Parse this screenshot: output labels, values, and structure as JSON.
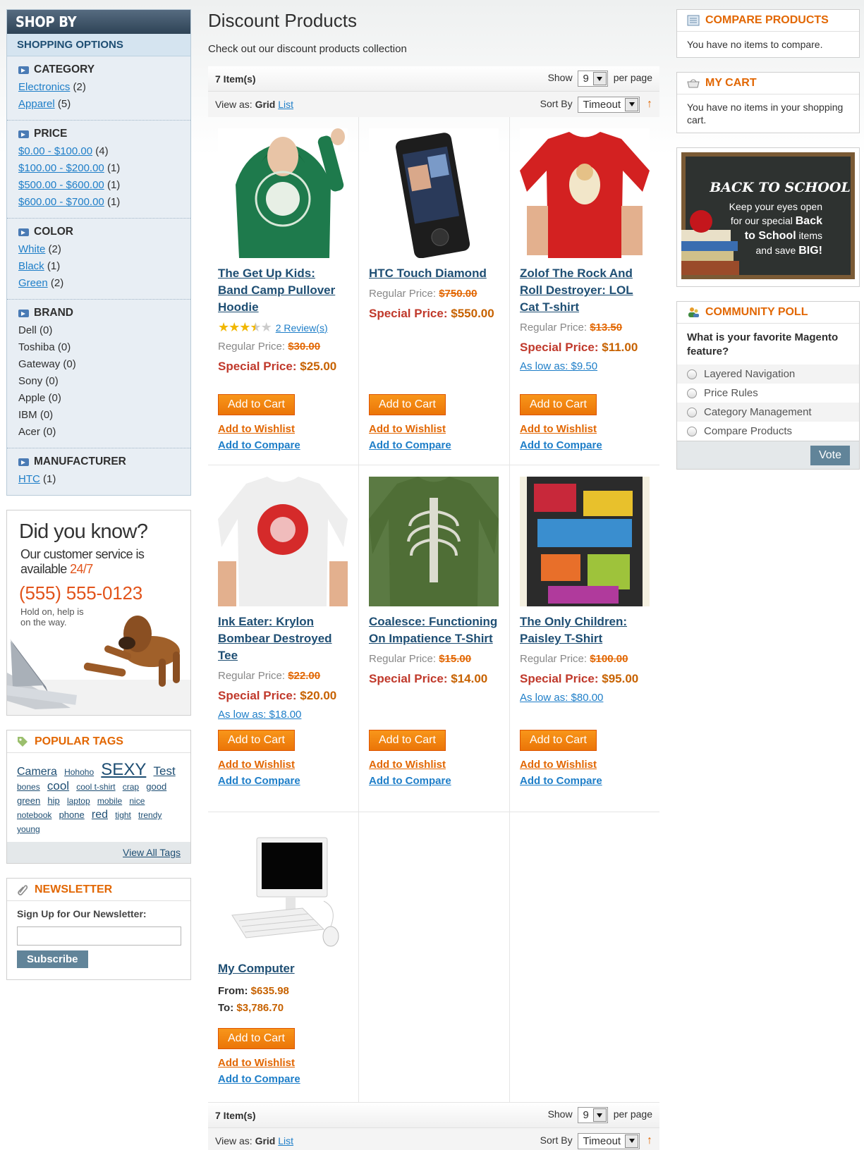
{
  "shopby": {
    "title": "SHOP BY",
    "subtitle": "SHOPPING OPTIONS",
    "filters": [
      {
        "name": "CATEGORY",
        "items": [
          {
            "label": "Electronics",
            "count": "(2)",
            "link": true
          },
          {
            "label": "Apparel",
            "count": "(5)",
            "link": true
          }
        ]
      },
      {
        "name": "PRICE",
        "items": [
          {
            "label": "$0.00 - $100.00",
            "count": "(4)",
            "link": true
          },
          {
            "label": "$100.00 - $200.00",
            "count": "(1)",
            "link": true
          },
          {
            "label": "$500.00 - $600.00",
            "count": "(1)",
            "link": true
          },
          {
            "label": "$600.00 - $700.00",
            "count": "(1)",
            "link": true
          }
        ]
      },
      {
        "name": "COLOR",
        "items": [
          {
            "label": "White",
            "count": "(2)",
            "link": true
          },
          {
            "label": "Black",
            "count": "(1)",
            "link": true
          },
          {
            "label": "Green",
            "count": "(2)",
            "link": true
          }
        ]
      },
      {
        "name": "BRAND",
        "items": [
          {
            "label": "Dell",
            "count": "(0)",
            "link": false
          },
          {
            "label": "Toshiba",
            "count": "(0)",
            "link": false
          },
          {
            "label": "Gateway",
            "count": "(0)",
            "link": false
          },
          {
            "label": "Sony",
            "count": "(0)",
            "link": false
          },
          {
            "label": "Apple",
            "count": "(0)",
            "link": false
          },
          {
            "label": "IBM",
            "count": "(0)",
            "link": false
          },
          {
            "label": "Acer",
            "count": "(0)",
            "link": false
          }
        ]
      },
      {
        "name": "MANUFACTURER",
        "items": [
          {
            "label": "HTC",
            "count": "(1)",
            "link": true
          }
        ]
      }
    ]
  },
  "didyouknow": {
    "title": "Did you know?",
    "line1": "Our customer service is",
    "line2": "available",
    "line2_highlight": "24/7",
    "phone": "(555) 555-0123",
    "hold1": "Hold on, help is",
    "hold2": "on the way."
  },
  "tags": {
    "title": "POPULAR TAGS",
    "items": [
      {
        "t": "Camera",
        "s": 3
      },
      {
        "t": "Hohoho",
        "s": 1
      },
      {
        "t": "SEXY",
        "s": 5
      },
      {
        "t": "Test",
        "s": 4
      },
      {
        "t": "bones",
        "s": 1
      },
      {
        "t": "cool",
        "s": 4
      },
      {
        "t": "cool t-shirt",
        "s": 1
      },
      {
        "t": "crap",
        "s": 1
      },
      {
        "t": "good",
        "s": 2
      },
      {
        "t": "green",
        "s": 2
      },
      {
        "t": "hip",
        "s": 2
      },
      {
        "t": "laptop",
        "s": 1
      },
      {
        "t": "mobile",
        "s": 1
      },
      {
        "t": "nice",
        "s": 1
      },
      {
        "t": "notebook",
        "s": 1
      },
      {
        "t": "phone",
        "s": 2
      },
      {
        "t": "red",
        "s": 3
      },
      {
        "t": "tight",
        "s": 1
      },
      {
        "t": "trendy",
        "s": 1
      },
      {
        "t": "young",
        "s": 1
      }
    ],
    "view_all": "View All Tags"
  },
  "newsletter": {
    "title": "NEWSLETTER",
    "label": "Sign Up for Our Newsletter:",
    "value": "",
    "button": "Subscribe"
  },
  "main": {
    "title": "Discount Products",
    "description": "Check out our discount products collection"
  },
  "toolbar": {
    "count": "7 Item(s)",
    "show_label": "Show",
    "show_value": "9",
    "per_page": "per page",
    "view_as": "View as:",
    "grid": "Grid",
    "list": "List",
    "sort_by": "Sort By",
    "sort_value": "Timeout",
    "sort_dir": "↑"
  },
  "products": [
    {
      "name": "The Get Up Kids: Band Camp Pullover Hoodie",
      "rating": 3.5,
      "reviews": "2 Review(s)",
      "regular_label": "Regular Price:",
      "regular": "$30.00",
      "special_label": "Special Price:",
      "special": "$25.00",
      "aslow": ""
    },
    {
      "name": "HTC Touch Diamond",
      "regular_label": "Regular Price:",
      "regular": "$750.00",
      "special_label": "Special Price:",
      "special": "$550.00",
      "aslow": ""
    },
    {
      "name": "Zolof The Rock And Roll Destroyer: LOL Cat T-shirt",
      "regular_label": "Regular Price:",
      "regular": "$13.50",
      "special_label": "Special Price:",
      "special": "$11.00",
      "aslow": "As low as: $9.50"
    },
    {
      "name": "Ink Eater: Krylon Bombear Destroyed Tee",
      "regular_label": "Regular Price:",
      "regular": "$22.00",
      "special_label": "Special Price:",
      "special": "$20.00",
      "aslow": "As low as: $18.00"
    },
    {
      "name": "Coalesce: Functioning On Impatience T-Shirt",
      "regular_label": "Regular Price:",
      "regular": "$15.00",
      "special_label": "Special Price:",
      "special": "$14.00",
      "aslow": ""
    },
    {
      "name": "The Only Children: Paisley T-Shirt",
      "regular_label": "Regular Price:",
      "regular": "$100.00",
      "special_label": "Special Price:",
      "special": "$95.00",
      "aslow": "As low as: $80.00"
    },
    {
      "name": "My Computer",
      "from_label": "From:",
      "from": "$635.98",
      "to_label": "To:",
      "to": "$3,786.70"
    }
  ],
  "product_actions": {
    "cart": "Add to Cart",
    "wishlist": "Add to Wishlist",
    "compare": "Add to Compare"
  },
  "compare": {
    "title": "COMPARE PRODUCTS",
    "text": "You have no items to compare."
  },
  "cart": {
    "title": "MY CART",
    "text": "You have no items in your shopping cart."
  },
  "promo": {
    "title": "BACK TO SCHOOL",
    "l1": "Keep your eyes open",
    "l2a": "for our special ",
    "l2b": "Back",
    "l3a": "to School",
    "l3b": " items",
    "l4a": "and save ",
    "l4b": "BIG!"
  },
  "poll": {
    "title": "COMMUNITY POLL",
    "question": "What is your favorite Magento feature?",
    "options": [
      "Layered Navigation",
      "Price Rules",
      "Category Management",
      "Compare Products"
    ],
    "button": "Vote"
  }
}
